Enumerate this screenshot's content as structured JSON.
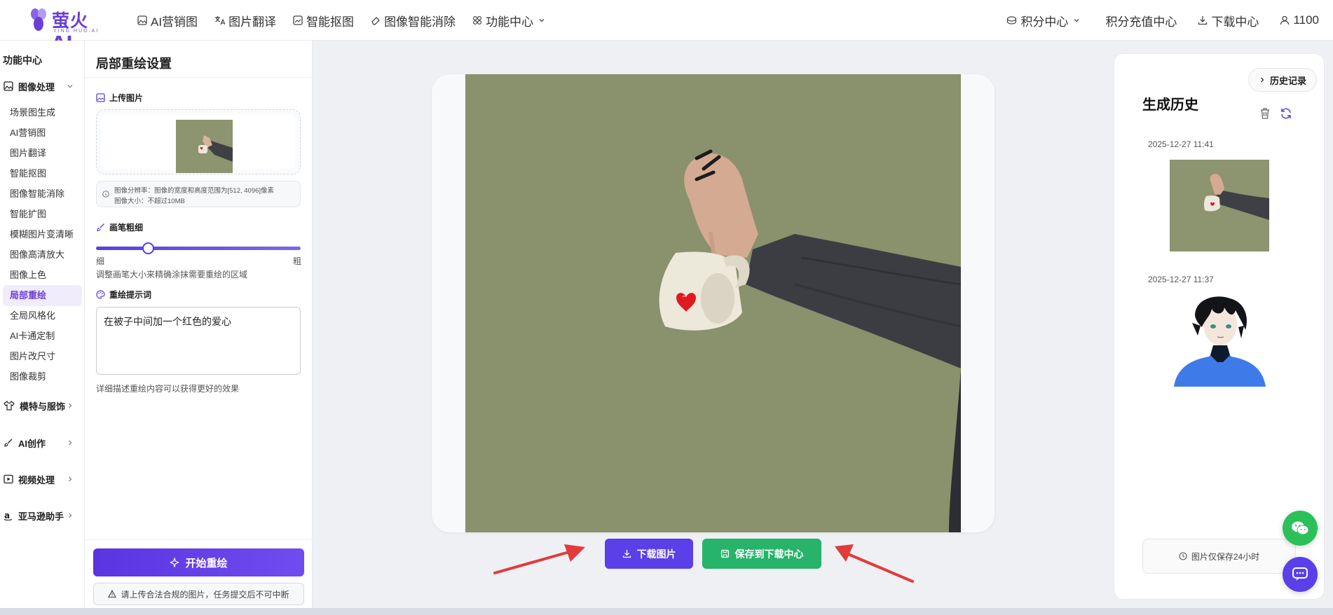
{
  "brand": {
    "name": "萤火AI",
    "sub": "YING HUO.AI"
  },
  "topnav": [
    {
      "label": "AI营销图",
      "icon": "image-icon"
    },
    {
      "label": "图片翻译",
      "icon": "translate-icon"
    },
    {
      "label": "智能抠图",
      "icon": "cutout-icon"
    },
    {
      "label": "图像智能消除",
      "icon": "eraser-icon"
    },
    {
      "label": "功能中心",
      "icon": "grid-icon"
    }
  ],
  "rightnav": {
    "points": "积分中心",
    "recharge": "积分充值中心",
    "downloads": "下载中心",
    "user_points": "1100"
  },
  "sidebar": {
    "title": "功能中心",
    "groups": [
      "图像处理",
      "模特与服饰",
      "AI创作",
      "视频处理",
      "亚马逊助手"
    ],
    "items": [
      "场景图生成",
      "AI营销图",
      "图片翻译",
      "智能抠图",
      "图像智能消除",
      "智能扩图",
      "模糊图片变清晰",
      "图像高清放大",
      "图像上色",
      "局部重绘",
      "全局风格化",
      "AI卡通定制",
      "图片改尺寸",
      "图像裁剪"
    ],
    "active": "局部重绘"
  },
  "panel": {
    "title": "局部重绘设置",
    "upload_label": "上传图片",
    "info_line1": "图像分辨率：图像的宽度和高度范围为[512, 4096]像素",
    "info_line2": "图像大小：不超过10MB",
    "brush_label": "画笔粗细",
    "brush_min": "细",
    "brush_max": "粗",
    "brush_value": 0.24,
    "brush_hint": "调整画笔大小来精确涂抹需要重绘的区域",
    "prompt_label": "重绘提示词",
    "prompt_value": "在被子中间加一个红色的爱心",
    "prompt_hint": "详细描述重绘内容可以获得更好的效果",
    "start_button": "开始重绘",
    "warning": "请上传合法合规的图片，任务提交后不可中断"
  },
  "actions": {
    "download": "下载图片",
    "save": "保存到下载中心"
  },
  "history": {
    "button": "历史记录",
    "title": "生成历史",
    "entries": [
      {
        "time": "2025-12-27 11:41"
      },
      {
        "time": "2025-12-27 11:37"
      }
    ],
    "keep_note": "图片仅保存24小时"
  },
  "colors": {
    "accent": "#5b3fe8",
    "green": "#27b36a",
    "arrow": "#e23b3b"
  }
}
